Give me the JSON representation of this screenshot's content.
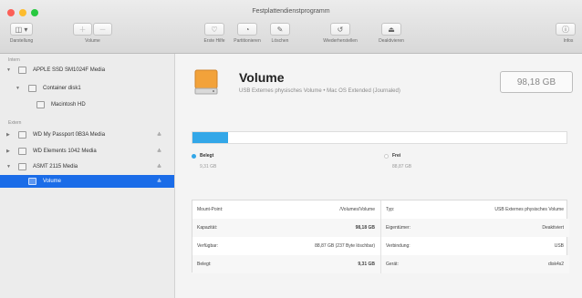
{
  "window": {
    "title": "Festplattendienstprogramm"
  },
  "toolbar": {
    "view_label": "Darstellung",
    "volume_label": "Volume",
    "firstaid_label": "Erste Hilfe",
    "partition_label": "Partitionieren",
    "erase_label": "Löschen",
    "restore_label": "Wiederherstellen",
    "unmount_label": "Deaktivieren",
    "info_label": "Infos"
  },
  "sidebar": {
    "section_internal": "Intern",
    "section_external": "Extern",
    "internal": [
      {
        "label": "APPLE SSD SM1024F Media",
        "disclosure": "▼"
      },
      {
        "label": "Container disk1",
        "disclosure": "▼"
      },
      {
        "label": "Macintosh HD",
        "disclosure": ""
      }
    ],
    "external": [
      {
        "label": "WD My Passport 0B3A Media",
        "disclosure": "▶",
        "eject": "≜"
      },
      {
        "label": "WD Elements 1042 Media",
        "disclosure": "▶",
        "eject": "≜"
      },
      {
        "label": "ASMT 2115 Media",
        "disclosure": "▼",
        "eject": "≜"
      },
      {
        "label": "Volume",
        "disclosure": "",
        "eject": "≜",
        "selected": true
      }
    ]
  },
  "volume": {
    "name": "Volume",
    "description": "USB Externes physisches Volume • Mac OS Extended (Journaled)",
    "size": "98,18 GB"
  },
  "usage": {
    "used_fraction": 0.094,
    "used_color": "#33a7e8",
    "free_color": "#ffffff",
    "used_title": "Belegt",
    "used_value": "9,31 GB",
    "free_title": "Frei",
    "free_value": "88,87 GB"
  },
  "info": {
    "left": [
      {
        "key": "Mount-Point:",
        "value": "/Volumes/Volume"
      },
      {
        "key": "Kapazität:",
        "value": "98,18 GB"
      },
      {
        "key": "Verfügbar:",
        "value": "88,87 GB (237 Byte löschbar)"
      },
      {
        "key": "Belegt:",
        "value": "9,31 GB"
      }
    ],
    "right": [
      {
        "key": "Typ:",
        "value": "USB Externes physisches Volume"
      },
      {
        "key": "Eigentümer:",
        "value": "Deaktiviert"
      },
      {
        "key": "Verbindung:",
        "value": "USB"
      },
      {
        "key": "Gerät:",
        "value": "disk4s2"
      }
    ]
  }
}
